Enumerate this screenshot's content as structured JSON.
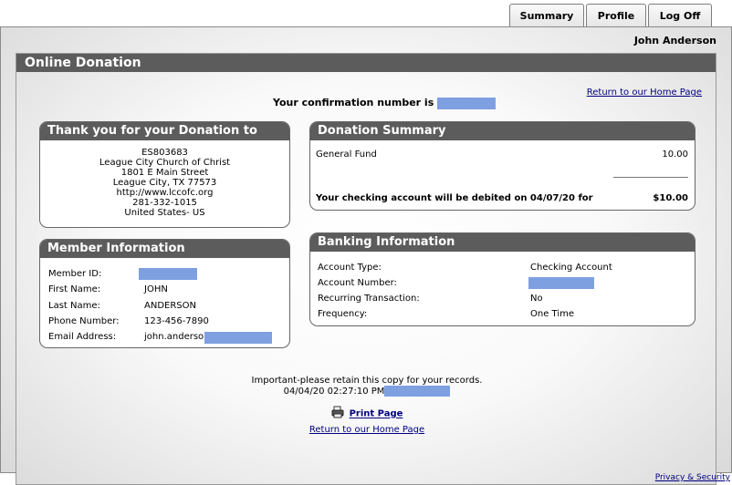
{
  "tabs": {
    "summary": "Summary",
    "profile": "Profile",
    "logoff": "Log Off"
  },
  "user_name": "John Anderson",
  "page_title": "Online Donation",
  "confirmation_label": "Your confirmation number is",
  "return_home": "Return to our Home Page",
  "thank_you": {
    "title": "Thank you for your Donation to",
    "lines": [
      "ES803683",
      "League City Church of Christ",
      "1801 E Main Street",
      "League City, TX 77573",
      "http://www.lccofc.org",
      "281-332-1015",
      "United States- US"
    ]
  },
  "donation_summary": {
    "title": "Donation Summary",
    "fund_label": "General Fund",
    "fund_amount": "10.00",
    "debit_text": "Your checking account will be debited on 04/07/20 for",
    "total": "$10.00"
  },
  "member_info": {
    "title": "Member Information",
    "member_id_label": "Member ID:",
    "first_name_label": "First Name:",
    "first_name": "JOHN",
    "last_name_label": "Last Name:",
    "last_name": "ANDERSON",
    "phone_label": "Phone Number:",
    "phone": "123-456-7890",
    "email_label": "Email Address:",
    "email": "john.anderson"
  },
  "banking_info": {
    "title": "Banking Information",
    "account_type_label": "Account Type:",
    "account_type": "Checking Account",
    "account_number_label": "Account Number:",
    "recurring_label": "Recurring Transaction:",
    "recurring": "No",
    "frequency_label": "Frequency:",
    "frequency": "One Time"
  },
  "footer": {
    "retain_text": "Important-please retain this copy for your records.",
    "timestamp": "04/04/20 02:27:10 PM",
    "print_label": "Print Page",
    "return_home": "Return to our Home Page"
  },
  "privacy": "Privacy & Security",
  "colors": {
    "header_bg": "#5c5c5c",
    "redaction": "#7ea0e0",
    "link": "#000080"
  }
}
